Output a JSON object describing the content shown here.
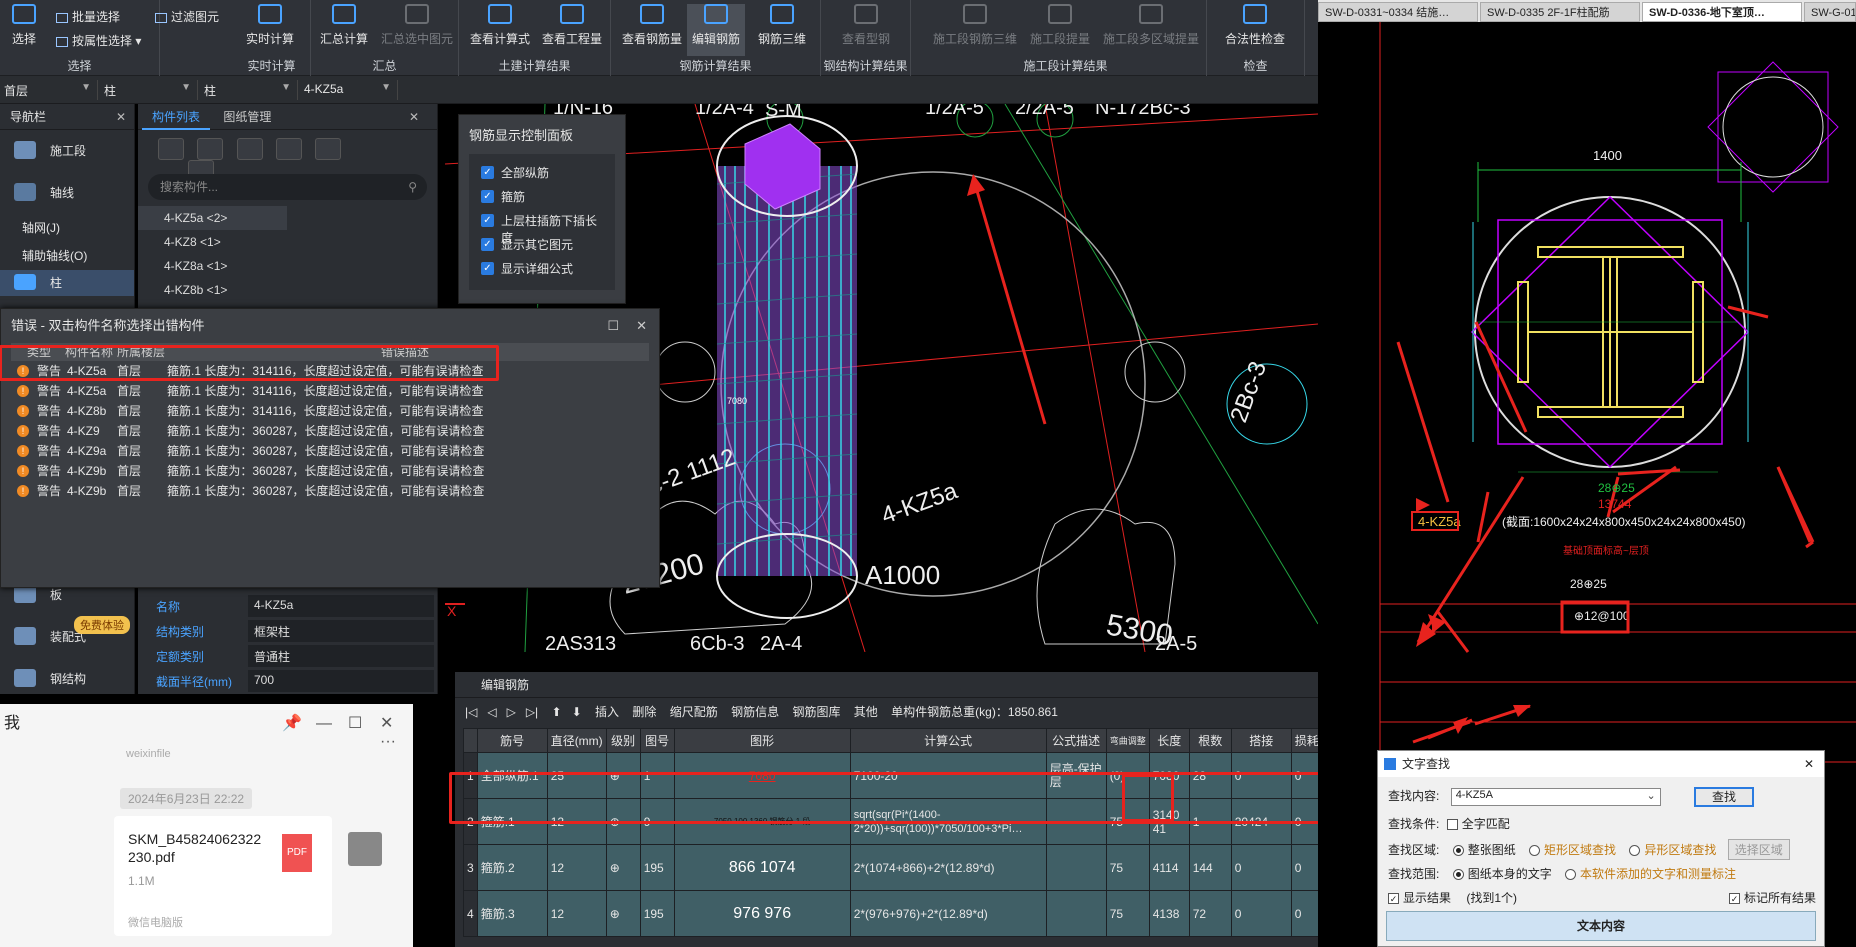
{
  "ribbon": {
    "select": {
      "btn": "选择",
      "batch": "批量选择",
      "by_prop": "按属性选择",
      "filter": "过滤图元",
      "group": "选择"
    },
    "realtime": {
      "btn": "实时计算",
      "group": "实时计算"
    },
    "summary": {
      "calc": "汇总计算",
      "calc_sel": "汇总选中图元",
      "group": "汇总"
    },
    "civil": {
      "view_formula": "查看计算式",
      "view_qty": "查看工程量",
      "group": "土建计算结果"
    },
    "rebar": {
      "view_qty": "查看钢筋量",
      "edit": "编辑钢筋",
      "three_d": "钢筋三维",
      "group": "钢筋计算结果"
    },
    "steel": {
      "view": "查看型钢",
      "group": "钢结构计算结果"
    },
    "stage": {
      "three_d": "施工段钢筋三维",
      "extract": "施工段提量",
      "multi": "施工段多区域提量",
      "group": "施工段计算结果"
    },
    "check": {
      "legal": "合法性检查",
      "group": "检查"
    }
  },
  "selectors": {
    "floor": "首层",
    "type1": "柱",
    "type2": "柱",
    "name": "4-KZ5a"
  },
  "nav": {
    "title": "导航栏",
    "items": [
      "施工段",
      "轴线"
    ],
    "sub": [
      "轴网(J)",
      "辅助轴线(O)"
    ],
    "item_col": "柱",
    "item_board": "板",
    "item_assembly": "装配式",
    "free_badge": "免费体验",
    "item_steel": "钢结构"
  },
  "comp": {
    "tab1": "构件列表",
    "tab2": "图纸管理",
    "search_placeholder": "搜索构件...",
    "items": [
      "4-KZ5a <2>",
      "4-KZ8 <1>",
      "4-KZ8a <1>",
      "4-KZ8b <1>"
    ]
  },
  "props": [
    {
      "k": "名称",
      "v": "4-KZ5a"
    },
    {
      "k": "结构类别",
      "v": "框架柱"
    },
    {
      "k": "定额类别",
      "v": "普通柱"
    },
    {
      "k": "截面半径(mm)",
      "v": "700"
    }
  ],
  "rebar_ctl": {
    "title": "钢筋显示控制面板",
    "options": [
      "全部纵筋",
      "箍筋",
      "上层柱插筋下插长度",
      "显示其它图元",
      "显示详细公式"
    ]
  },
  "error": {
    "title": "错误 - 双击构件名称选择出错构件",
    "headers": [
      "类型",
      "构件名称",
      "所属楼层",
      "错误描述"
    ],
    "rows": [
      {
        "type": "警告",
        "name": "4-KZ5a",
        "floor": "首层",
        "desc": "箍筋.1 长度为：314116，长度超过设定值，可能有误请检查"
      },
      {
        "type": "警告",
        "name": "4-KZ5a",
        "floor": "首层",
        "desc": "箍筋.1 长度为：314116，长度超过设定值，可能有误请检查"
      },
      {
        "type": "警告",
        "name": "4-KZ8b",
        "floor": "首层",
        "desc": "箍筋.1 长度为：314116，长度超过设定值，可能有误请检查"
      },
      {
        "type": "警告",
        "name": "4-KZ9",
        "floor": "首层",
        "desc": "箍筋.1 长度为：360287，长度超过设定值，可能有误请检查"
      },
      {
        "type": "警告",
        "name": "4-KZ9a",
        "floor": "首层",
        "desc": "箍筋.1 长度为：360287，长度超过设定值，可能有误请检查"
      },
      {
        "type": "警告",
        "name": "4-KZ9b",
        "floor": "首层",
        "desc": "箍筋.1 长度为：360287，长度超过设定值，可能有误请检查"
      },
      {
        "type": "警告",
        "name": "4-KZ9b",
        "floor": "首层",
        "desc": "箍筋.1 长度为：360287，长度超过设定值，可能有误请检查"
      }
    ]
  },
  "chat": {
    "partial_title": "我",
    "sender": "weixinfile",
    "date": "2024年6月23日 22:22",
    "file_name": "SKM_B45824062322230.pdf",
    "file_size": "1.1M",
    "source": "微信电脑版",
    "pdf_label": "PDF"
  },
  "cad3d": {
    "axes": [
      "1/N-16",
      "1/2A-4",
      "S-M",
      "1/2A-5",
      "2/2A-5",
      "N-172Bc-3"
    ],
    "bottom_axes": [
      "2AS313",
      "6Cb-3",
      "2A-4",
      "2A-5"
    ],
    "labels": [
      "23200",
      "5300",
      "A1000",
      "4-KZ5a",
      "2Bc-2 1112",
      "2Bc-3",
      "7080"
    ],
    "axis_x": "X"
  },
  "edit": {
    "title": "编辑钢筋",
    "toolbar": [
      "插入",
      "删除",
      "缩尺配筋",
      "钢筋信息",
      "钢筋图库",
      "其他",
      "单构件钢筋总重(kg)：1850.861"
    ],
    "headers": [
      "筋号",
      "直径(mm)",
      "级别",
      "图号",
      "图形",
      "计算公式",
      "公式描述",
      "弯曲调整",
      "长度",
      "根数",
      "搭接",
      "损耗"
    ],
    "rows": [
      {
        "n": "1",
        "name": "全部纵筋.1",
        "d": "25",
        "g": "⊕",
        "fig": "1",
        "shape": "7080",
        "formula": "7100-20",
        "desc": "层高-保护层",
        "adj": "(0)",
        "len": "7080",
        "cnt": "28",
        "lap": "0",
        "loss": "0"
      },
      {
        "n": "2",
        "name": "箍筋.1",
        "d": "12",
        "g": "⊕",
        "fig": "9",
        "shape": "7050 100 1360 钢筋分 1 段",
        "formula": "sqrt(sqr(Pi*(1400-2*20))+sqr(100))*7050/100+3*Pi…",
        "desc": "",
        "adj": "75",
        "len": "314041",
        "cnt": "1",
        "lap": "20424",
        "loss": "0"
      },
      {
        "n": "3",
        "name": "箍筋.2",
        "d": "12",
        "g": "⊕",
        "fig": "195",
        "shape": "866 1074",
        "formula": "2*(1074+866)+2*(12.89*d)",
        "desc": "",
        "adj": "75",
        "len": "4114",
        "cnt": "144",
        "lap": "0",
        "loss": "0"
      },
      {
        "n": "4",
        "name": "箍筋.3",
        "d": "12",
        "g": "⊕",
        "fig": "195",
        "shape": "976 976",
        "formula": "2*(976+976)+2*(12.89*d)",
        "desc": "",
        "adj": "75",
        "len": "4138",
        "cnt": "72",
        "lap": "0",
        "loss": "0"
      }
    ]
  },
  "cad_tabs": [
    "SW-D-0331~0334 结施…",
    "SW-D-0335 2F-1F柱配筋",
    "SW-D-0336-地下室顶…",
    "SW-G-0101"
  ],
  "cad2d": {
    "dim": "1400",
    "rebar": "28⊕25",
    "len": "13744",
    "kz": "4-KZ5a",
    "section": "(截面:1600x24x24x800x450x24x24x800x450)",
    "stirrup": "⊕12@100",
    "rebar2": "28⊕25",
    "note": "基础顶面标高~层顶"
  },
  "tfind": {
    "title": "文字查找",
    "content_label": "查找内容:",
    "content": "4-KZ5A",
    "find_btn": "查找",
    "cond_label": "查找条件:",
    "full_match": "全字匹配",
    "area_label": "查找区域:",
    "areas": [
      "整张图纸",
      "矩形区域查找",
      "异形区域查找"
    ],
    "select_area": "选择区域",
    "scope_label": "查找范围:",
    "scopes": [
      "图纸本身的文字",
      "本软件添加的文字和测量标注"
    ],
    "show_result": "显示结果",
    "found": "(找到1个)",
    "mark_all": "标记所有结果",
    "result_col": "文本内容"
  },
  "colors": {
    "accent": "#4aa3ff",
    "warning": "#f08a24",
    "highlight": "#e8231e",
    "cad_magenta": "#c000ff",
    "cad_cyan": "#36d6e7"
  }
}
